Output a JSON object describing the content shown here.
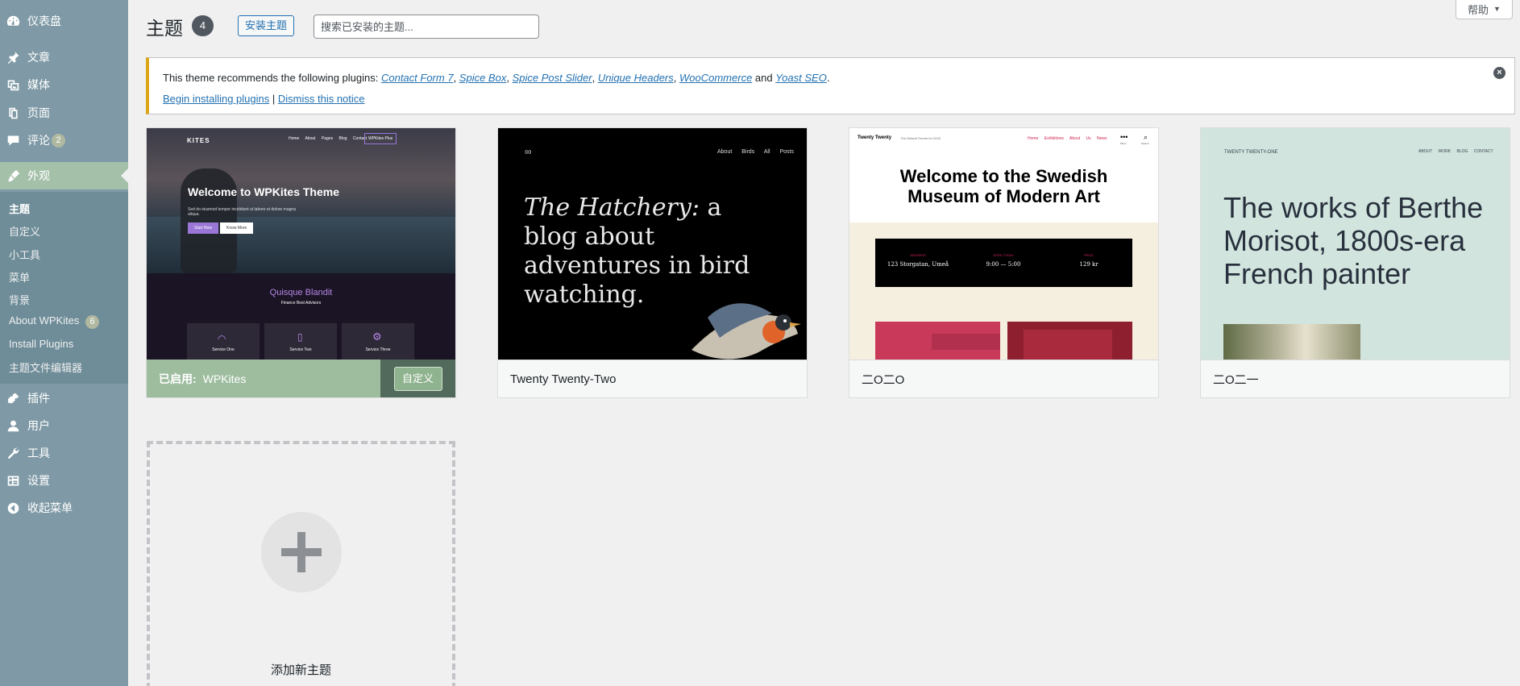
{
  "sidebar": {
    "items": [
      {
        "label": "仪表盘",
        "icon": "dashboard-icon"
      },
      {
        "label": "文章",
        "icon": "pin-icon"
      },
      {
        "label": "媒体",
        "icon": "media-icon"
      },
      {
        "label": "页面",
        "icon": "page-icon"
      },
      {
        "label": "评论",
        "icon": "comment-icon",
        "count": "2"
      },
      {
        "label": "外观",
        "icon": "brush-icon",
        "active": true
      },
      {
        "label": "插件",
        "icon": "plugin-icon"
      },
      {
        "label": "用户",
        "icon": "user-icon"
      },
      {
        "label": "工具",
        "icon": "wrench-icon"
      },
      {
        "label": "设置",
        "icon": "settings-icon"
      },
      {
        "label": "收起菜单",
        "icon": "collapse-icon"
      }
    ],
    "submenu": [
      {
        "label": "主题",
        "current": true
      },
      {
        "label": "自定义"
      },
      {
        "label": "小工具"
      },
      {
        "label": "菜单"
      },
      {
        "label": "背景"
      },
      {
        "label": "About WPKites",
        "count": "6"
      },
      {
        "label": "Install Plugins"
      },
      {
        "label": "主题文件编辑器"
      }
    ]
  },
  "header": {
    "title": "主题",
    "count": "4",
    "add_button": "安装主题",
    "search_placeholder": "搜索已安装的主题...",
    "help_label": "帮助"
  },
  "notice": {
    "prefix": "This theme recommends the following plugins: ",
    "plugins": [
      "Contact Form 7",
      "Spice Box",
      "Spice Post Slider",
      "Unique Headers",
      "WooCommerce",
      "Yoast SEO"
    ],
    "sep": ", ",
    "and": " and ",
    "period": ".",
    "begin_link": "Begin installing plugins",
    "divider": " | ",
    "dismiss_link": "Dismiss this notice"
  },
  "themes": [
    {
      "name": "WPKites",
      "active_label": "已启用:",
      "customize_label": "自定义",
      "shot": {
        "logo": "KITES",
        "nav": [
          "Home",
          "About",
          "Pages",
          "Blog",
          "Contact"
        ],
        "nav_button": "WPKites Plus",
        "hero_title": "Welcome to WPKites Theme",
        "hero_text": "Sed do eiusmod tempor incididunt ut labore et dolore magna aliqua.",
        "btn1": "Start Now",
        "btn2": "Know More",
        "section_title": "Quisque Blandit",
        "section_sub": "Finance Best Advisors",
        "services": [
          "Service One",
          "Service Two",
          "Service Three"
        ]
      }
    },
    {
      "name": "Twenty Twenty-Two",
      "shot": {
        "nav": [
          "About",
          "Birds",
          "All Posts"
        ],
        "headline_italic": "The Hatchery:",
        "headline_rest": " a blog about adventures in bird watching."
      }
    },
    {
      "name": "二O二O",
      "shot": {
        "site_title": "Twenty Twenty",
        "tagline": "The Default Theme for 2020",
        "nav": [
          "Home",
          "Exhibitions",
          "About Us",
          "News"
        ],
        "menu_label": "Menu",
        "search_label": "Search",
        "headline": "Welcome to the Swedish Museum of Modern Art",
        "info": [
          {
            "label": "ADDRESS",
            "value": "123 Storgatan, Umeå"
          },
          {
            "label": "OPEN TODAY",
            "value": "9:00 — 5:00"
          },
          {
            "label": "PRICE",
            "value": "129 kr"
          }
        ]
      }
    },
    {
      "name": "二O二一",
      "shot": {
        "site_title": "TWENTY TWENTY-ONE",
        "nav": [
          "ABOUT",
          "WORK",
          "BLOG",
          "CONTACT"
        ],
        "headline": "The works of Berthe Morisot, 1800s-era French painter"
      }
    }
  ],
  "add_new_label": "添加新主题",
  "colors": {
    "sidebar": "#7f9aa6",
    "active_menu": "#a4c0a9",
    "link": "#2271b1",
    "notice_border": "#dba617"
  }
}
